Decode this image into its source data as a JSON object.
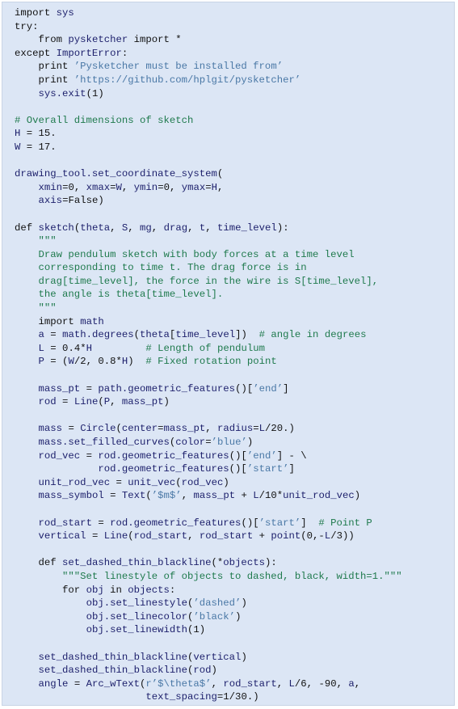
{
  "colors": {
    "background": "#dce6f5",
    "name": "#1c1f6b",
    "string": "#4a78a6",
    "comment": "#1f7a4d",
    "keyword": "#111111"
  },
  "lines": [
    [
      [
        "import ",
        "p"
      ],
      [
        "sys",
        "n"
      ]
    ],
    [
      [
        "try:",
        "p"
      ]
    ],
    [
      [
        "    from ",
        "p"
      ],
      [
        "pysketcher",
        "n"
      ],
      [
        " import *",
        "p"
      ]
    ],
    [
      [
        "except ",
        "p"
      ],
      [
        "ImportError",
        "n"
      ],
      [
        ":",
        "p"
      ]
    ],
    [
      [
        "    print ",
        "p"
      ],
      [
        "’Pysketcher must be installed from’",
        "s"
      ]
    ],
    [
      [
        "    print ",
        "p"
      ],
      [
        "’https://github.com/hplgit/pysketcher’",
        "s"
      ]
    ],
    [
      [
        "    ",
        "p"
      ],
      [
        "sys.exit",
        "n"
      ],
      [
        "(1)",
        "p"
      ]
    ],
    [],
    [
      [
        "# Overall dimensions of sketch",
        "c"
      ]
    ],
    [
      [
        "H",
        "n"
      ],
      [
        " = 15.",
        "p"
      ]
    ],
    [
      [
        "W",
        "n"
      ],
      [
        " = 17.",
        "p"
      ]
    ],
    [],
    [
      [
        "drawing_tool.set_coordinate_system",
        "n"
      ],
      [
        "(",
        "p"
      ]
    ],
    [
      [
        "    ",
        "p"
      ],
      [
        "xmin",
        "n"
      ],
      [
        "=0, ",
        "p"
      ],
      [
        "xmax",
        "n"
      ],
      [
        "=",
        "p"
      ],
      [
        "W",
        "n"
      ],
      [
        ", ",
        "p"
      ],
      [
        "ymin",
        "n"
      ],
      [
        "=0, ",
        "p"
      ],
      [
        "ymax",
        "n"
      ],
      [
        "=",
        "p"
      ],
      [
        "H",
        "n"
      ],
      [
        ",",
        "p"
      ]
    ],
    [
      [
        "    ",
        "p"
      ],
      [
        "axis",
        "n"
      ],
      [
        "=False)",
        "p"
      ]
    ],
    [],
    [
      [
        "def ",
        "p"
      ],
      [
        "sketch",
        "n"
      ],
      [
        "(",
        "p"
      ],
      [
        "theta",
        "n"
      ],
      [
        ", ",
        "p"
      ],
      [
        "S",
        "n"
      ],
      [
        ", ",
        "p"
      ],
      [
        "mg",
        "n"
      ],
      [
        ", ",
        "p"
      ],
      [
        "drag",
        "n"
      ],
      [
        ", ",
        "p"
      ],
      [
        "t",
        "n"
      ],
      [
        ", ",
        "p"
      ],
      [
        "time_level",
        "n"
      ],
      [
        "):",
        "p"
      ]
    ],
    [
      [
        "    \"\"\"",
        "c"
      ]
    ],
    [
      [
        "    Draw pendulum sketch with body forces at a time level",
        "c"
      ]
    ],
    [
      [
        "    corresponding to time t. The drag force is in",
        "c"
      ]
    ],
    [
      [
        "    drag[time_level], the force in the wire is S[time_level],",
        "c"
      ]
    ],
    [
      [
        "    the angle is theta[time_level].",
        "c"
      ]
    ],
    [
      [
        "    \"\"\"",
        "c"
      ]
    ],
    [
      [
        "    import ",
        "p"
      ],
      [
        "math",
        "n"
      ]
    ],
    [
      [
        "    ",
        "p"
      ],
      [
        "a",
        "n"
      ],
      [
        " = ",
        "p"
      ],
      [
        "math.degrees",
        "n"
      ],
      [
        "(",
        "p"
      ],
      [
        "theta",
        "n"
      ],
      [
        "[",
        "p"
      ],
      [
        "time_level",
        "n"
      ],
      [
        "])  ",
        "p"
      ],
      [
        "# angle in degrees",
        "c"
      ]
    ],
    [
      [
        "    ",
        "p"
      ],
      [
        "L",
        "n"
      ],
      [
        " = 0.4*",
        "p"
      ],
      [
        "H",
        "n"
      ],
      [
        "         ",
        "p"
      ],
      [
        "# Length of pendulum",
        "c"
      ]
    ],
    [
      [
        "    ",
        "p"
      ],
      [
        "P",
        "n"
      ],
      [
        " = (",
        "p"
      ],
      [
        "W",
        "n"
      ],
      [
        "/2, 0.8*",
        "p"
      ],
      [
        "H",
        "n"
      ],
      [
        ")  ",
        "p"
      ],
      [
        "# Fixed rotation point",
        "c"
      ]
    ],
    [],
    [
      [
        "    ",
        "p"
      ],
      [
        "mass_pt",
        "n"
      ],
      [
        " = ",
        "p"
      ],
      [
        "path.geometric_features",
        "n"
      ],
      [
        "()[",
        "p"
      ],
      [
        "’end’",
        "s"
      ],
      [
        "]",
        "p"
      ]
    ],
    [
      [
        "    ",
        "p"
      ],
      [
        "rod",
        "n"
      ],
      [
        " = ",
        "p"
      ],
      [
        "Line",
        "n"
      ],
      [
        "(",
        "p"
      ],
      [
        "P",
        "n"
      ],
      [
        ", ",
        "p"
      ],
      [
        "mass_pt",
        "n"
      ],
      [
        ")",
        "p"
      ]
    ],
    [],
    [
      [
        "    ",
        "p"
      ],
      [
        "mass",
        "n"
      ],
      [
        " = ",
        "p"
      ],
      [
        "Circle",
        "n"
      ],
      [
        "(",
        "p"
      ],
      [
        "center",
        "n"
      ],
      [
        "=",
        "p"
      ],
      [
        "mass_pt",
        "n"
      ],
      [
        ", ",
        "p"
      ],
      [
        "radius",
        "n"
      ],
      [
        "=",
        "p"
      ],
      [
        "L",
        "n"
      ],
      [
        "/20.)",
        "p"
      ]
    ],
    [
      [
        "    ",
        "p"
      ],
      [
        "mass.set_filled_curves",
        "n"
      ],
      [
        "(",
        "p"
      ],
      [
        "color",
        "n"
      ],
      [
        "=",
        "p"
      ],
      [
        "’blue’",
        "s"
      ],
      [
        ")",
        "p"
      ]
    ],
    [
      [
        "    ",
        "p"
      ],
      [
        "rod_vec",
        "n"
      ],
      [
        " = ",
        "p"
      ],
      [
        "rod.geometric_features",
        "n"
      ],
      [
        "()[",
        "p"
      ],
      [
        "’end’",
        "s"
      ],
      [
        "] - \\",
        "p"
      ]
    ],
    [
      [
        "              ",
        "p"
      ],
      [
        "rod.geometric_features",
        "n"
      ],
      [
        "()[",
        "p"
      ],
      [
        "’start’",
        "s"
      ],
      [
        "]",
        "p"
      ]
    ],
    [
      [
        "    ",
        "p"
      ],
      [
        "unit_rod_vec",
        "n"
      ],
      [
        " = ",
        "p"
      ],
      [
        "unit_vec",
        "n"
      ],
      [
        "(",
        "p"
      ],
      [
        "rod_vec",
        "n"
      ],
      [
        ")",
        "p"
      ]
    ],
    [
      [
        "    ",
        "p"
      ],
      [
        "mass_symbol",
        "n"
      ],
      [
        " = ",
        "p"
      ],
      [
        "Text",
        "n"
      ],
      [
        "(",
        "p"
      ],
      [
        "’$m$’",
        "s"
      ],
      [
        ", ",
        "p"
      ],
      [
        "mass_pt",
        "n"
      ],
      [
        " + ",
        "p"
      ],
      [
        "L",
        "n"
      ],
      [
        "/10*",
        "p"
      ],
      [
        "unit_rod_vec",
        "n"
      ],
      [
        ")",
        "p"
      ]
    ],
    [],
    [
      [
        "    ",
        "p"
      ],
      [
        "rod_start",
        "n"
      ],
      [
        " = ",
        "p"
      ],
      [
        "rod.geometric_features",
        "n"
      ],
      [
        "()[",
        "p"
      ],
      [
        "’start’",
        "s"
      ],
      [
        "]  ",
        "p"
      ],
      [
        "# Point P",
        "c"
      ]
    ],
    [
      [
        "    ",
        "p"
      ],
      [
        "vertical",
        "n"
      ],
      [
        " = ",
        "p"
      ],
      [
        "Line",
        "n"
      ],
      [
        "(",
        "p"
      ],
      [
        "rod_start",
        "n"
      ],
      [
        ", ",
        "p"
      ],
      [
        "rod_start",
        "n"
      ],
      [
        " + ",
        "p"
      ],
      [
        "point",
        "n"
      ],
      [
        "(0,-",
        "p"
      ],
      [
        "L",
        "n"
      ],
      [
        "/3))",
        "p"
      ]
    ],
    [],
    [
      [
        "    def ",
        "p"
      ],
      [
        "set_dashed_thin_blackline",
        "n"
      ],
      [
        "(*",
        "p"
      ],
      [
        "objects",
        "n"
      ],
      [
        "):",
        "p"
      ]
    ],
    [
      [
        "        \"\"\"Set linestyle of objects to dashed, black, width=1.\"\"\"",
        "c"
      ]
    ],
    [
      [
        "        for ",
        "p"
      ],
      [
        "obj",
        "n"
      ],
      [
        " in ",
        "p"
      ],
      [
        "objects",
        "n"
      ],
      [
        ":",
        "p"
      ]
    ],
    [
      [
        "            ",
        "p"
      ],
      [
        "obj.set_linestyle",
        "n"
      ],
      [
        "(",
        "p"
      ],
      [
        "’dashed’",
        "s"
      ],
      [
        ")",
        "p"
      ]
    ],
    [
      [
        "            ",
        "p"
      ],
      [
        "obj.set_linecolor",
        "n"
      ],
      [
        "(",
        "p"
      ],
      [
        "’black’",
        "s"
      ],
      [
        ")",
        "p"
      ]
    ],
    [
      [
        "            ",
        "p"
      ],
      [
        "obj.set_linewidth",
        "n"
      ],
      [
        "(1)",
        "p"
      ]
    ],
    [],
    [
      [
        "    ",
        "p"
      ],
      [
        "set_dashed_thin_blackline",
        "n"
      ],
      [
        "(",
        "p"
      ],
      [
        "vertical",
        "n"
      ],
      [
        ")",
        "p"
      ]
    ],
    [
      [
        "    ",
        "p"
      ],
      [
        "set_dashed_thin_blackline",
        "n"
      ],
      [
        "(",
        "p"
      ],
      [
        "rod",
        "n"
      ],
      [
        ")",
        "p"
      ]
    ],
    [
      [
        "    ",
        "p"
      ],
      [
        "angle",
        "n"
      ],
      [
        " = ",
        "p"
      ],
      [
        "Arc_wText",
        "n"
      ],
      [
        "(",
        "p"
      ],
      [
        "r’$\\theta$’",
        "s"
      ],
      [
        ", ",
        "p"
      ],
      [
        "rod_start",
        "n"
      ],
      [
        ", ",
        "p"
      ],
      [
        "L",
        "n"
      ],
      [
        "/6, -90, ",
        "p"
      ],
      [
        "a",
        "n"
      ],
      [
        ",",
        "p"
      ]
    ],
    [
      [
        "                      ",
        "p"
      ],
      [
        "text_spacing",
        "n"
      ],
      [
        "=1/30.)",
        "p"
      ]
    ]
  ]
}
